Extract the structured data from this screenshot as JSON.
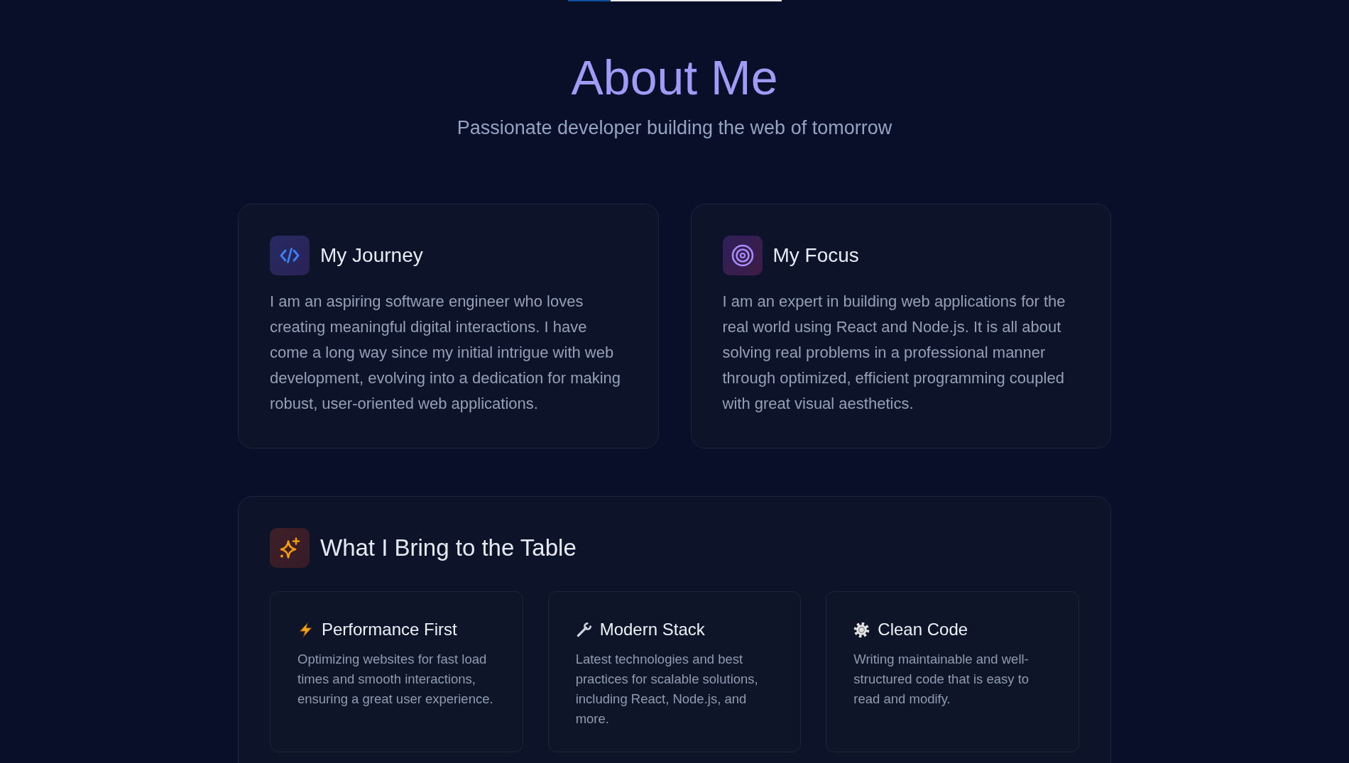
{
  "header": {
    "title": "About Me",
    "subtitle": "Passionate developer building the web of tomorrow"
  },
  "cards": [
    {
      "title": "My Journey",
      "text": "I am an aspiring software engineer who loves creating meaningful digital interactions. I have come a long way since my initial intrigue with web development, evolving into a dedication for making robust, user-oriented web applications."
    },
    {
      "title": "My Focus",
      "text": "I am an expert in building web applications for the real world using React and Node.js. It is all about solving real problems in a professional manner through optimized, efficient programming coupled with great visual aesthetics."
    }
  ],
  "strengths": {
    "title": "What I Bring to the Table",
    "items": [
      {
        "title": "Performance First",
        "text": "Optimizing websites for fast load times and smooth interactions, ensuring a great user experience."
      },
      {
        "title": "Modern Stack",
        "text": "Latest technologies and best practices for scalable solutions, including React, Node.js, and more."
      },
      {
        "title": "Clean Code",
        "text": "Writing maintainable and well-structured code that is easy to read and modify."
      }
    ]
  }
}
